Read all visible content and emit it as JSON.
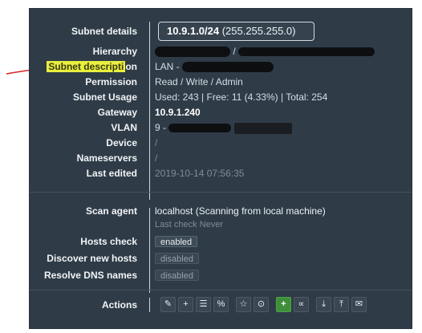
{
  "subnet_details": {
    "label": "Subnet details",
    "cidr": "10.9.1.0/24",
    "mask": "(255.255.255.0)"
  },
  "hierarchy": {
    "label": "Hierarchy",
    "value": "/"
  },
  "description": {
    "label_highlight": "Subnet descripti",
    "label_rest": "on",
    "value": "LAN - "
  },
  "permission": {
    "label": "Permission",
    "value": "Read / Write / Admin"
  },
  "usage": {
    "label": "Subnet Usage",
    "value": "Used: 243 | Free: 11 (4.33%) | Total: 254"
  },
  "gateway": {
    "label": "Gateway",
    "value": "10.9.1.240"
  },
  "vlan": {
    "label": "VLAN",
    "value": "9 - "
  },
  "device": {
    "label": "Device",
    "value": "/"
  },
  "nameservers": {
    "label": "Nameservers",
    "value": "/"
  },
  "last_edited": {
    "label": "Last edited",
    "value": "2019-10-14 07:56:35"
  },
  "scan_agent": {
    "label": "Scan agent",
    "value": "localhost (Scanning from local machine)",
    "last_check": "Last check Never"
  },
  "hosts_check": {
    "label": "Hosts check",
    "value": "enabled"
  },
  "discover_hosts": {
    "label": "Discover new hosts",
    "value": "disabled"
  },
  "resolve_dns": {
    "label": "Resolve DNS names",
    "value": "disabled"
  },
  "actions": {
    "label": "Actions",
    "buttons": [
      {
        "name": "edit-icon",
        "glyph": "✎"
      },
      {
        "name": "add-circle-icon",
        "glyph": "+"
      },
      {
        "name": "list-icon",
        "glyph": "☰"
      },
      {
        "name": "link-icon",
        "glyph": "%"
      },
      {
        "name": "star-icon",
        "glyph": "☆"
      },
      {
        "name": "clock-icon",
        "glyph": "⊙"
      },
      {
        "name": "add-ip-icon",
        "glyph": "+"
      },
      {
        "name": "share-icon",
        "glyph": "∝"
      },
      {
        "name": "download-icon",
        "glyph": "⤓"
      },
      {
        "name": "upload-icon",
        "glyph": "⤒"
      },
      {
        "name": "mail-icon",
        "glyph": "✉"
      }
    ]
  },
  "colors": {
    "panel": "#2f3c48",
    "highlight": "#e9ef3d",
    "annotation": "#d62626",
    "green": "#3f8f3a"
  }
}
